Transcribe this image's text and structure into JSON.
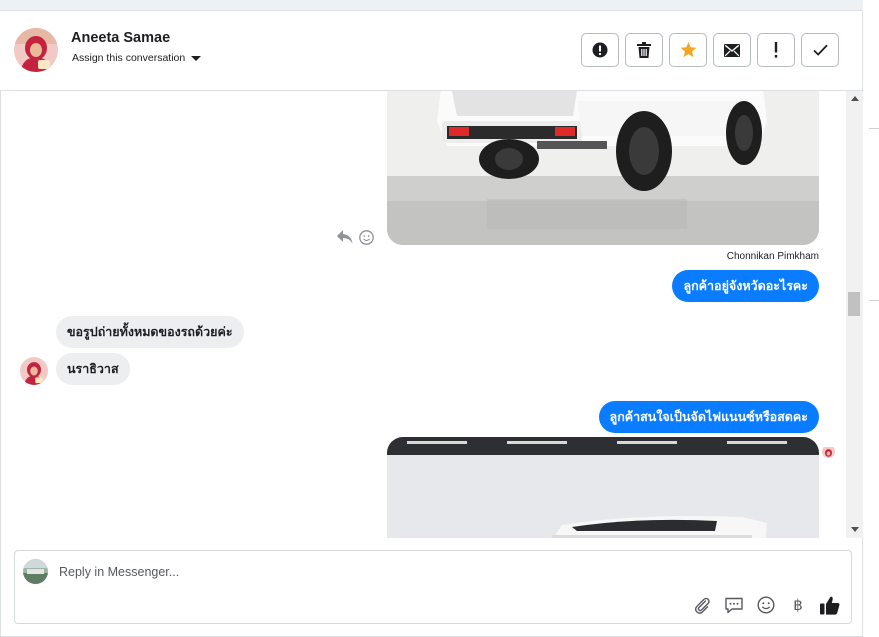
{
  "contact": {
    "name": "Aneeta Samae",
    "assign_label": "Assign this conversation"
  },
  "toolbar": {
    "buttons": [
      {
        "name": "mark-spam-button",
        "icon": "exclamation-circle-icon"
      },
      {
        "name": "delete-button",
        "icon": "trash-icon"
      },
      {
        "name": "star-button",
        "icon": "star-icon",
        "color": "#f5a623"
      },
      {
        "name": "mark-unread-button",
        "icon": "envelope-icon"
      },
      {
        "name": "follow-up-button",
        "icon": "exclamation-icon"
      },
      {
        "name": "mark-done-button",
        "icon": "checkmark-icon"
      }
    ]
  },
  "thread": {
    "sender_label": "Chonnikan Pimkham",
    "messages": [
      {
        "direction": "out",
        "text": "ลูกค้าอยู่จังหวัดอะไรคะ"
      },
      {
        "direction": "in",
        "text": "ขอรูปถ่ายทั้งหมดของรถด้วยค่ะ"
      },
      {
        "direction": "in",
        "text": "นราธิวาส"
      },
      {
        "direction": "out",
        "text": "ลูกค้าสนใจเป็นจัดไฟแนนซ์หรือสดคะ"
      }
    ],
    "colors": {
      "outgoing": "#0a7cff",
      "incoming": "#eceef0"
    }
  },
  "reply": {
    "placeholder": "Reply in Messenger...",
    "icons": [
      "paperclip-icon",
      "saved-replies-icon",
      "emoji-icon",
      "baht-icon",
      "thumbs-up-icon"
    ],
    "baht_glyph": "฿"
  }
}
